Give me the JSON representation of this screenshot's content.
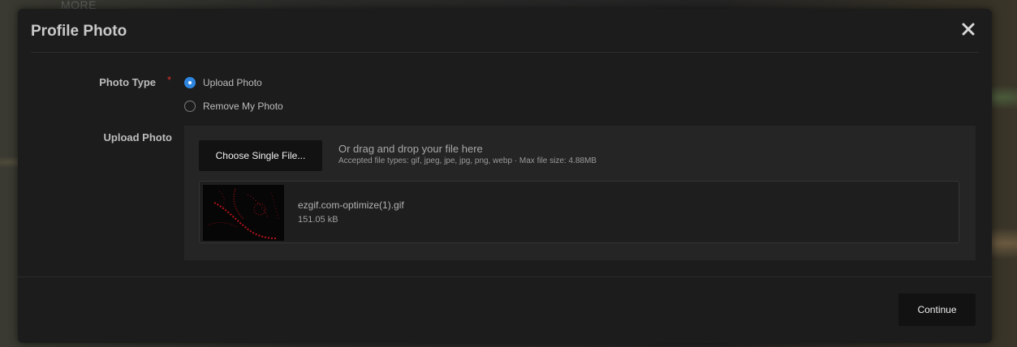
{
  "background": {
    "nav_label": "MORE"
  },
  "modal": {
    "title": "Profile Photo",
    "close_icon": "close-icon"
  },
  "photo_type": {
    "label": "Photo Type",
    "required_mark": "*",
    "options": [
      {
        "label": "Upload Photo",
        "checked": true
      },
      {
        "label": "Remove My Photo",
        "checked": false
      }
    ]
  },
  "upload": {
    "label": "Upload Photo",
    "choose_button": "Choose Single File...",
    "drop_text": "Or drag and drop your file here",
    "accepted_text": "Accepted file types: gif, jpeg, jpe, jpg, png, webp · Max file size: 4.88MB",
    "file": {
      "name": "ezgif.com-optimize(1).gif",
      "size": "151.05 kB"
    }
  },
  "footer": {
    "continue_button": "Continue"
  },
  "colors": {
    "accent": "#2f86e1",
    "required": "#d9312b",
    "modal_bg": "#1c1c1c",
    "panel_bg": "#252525",
    "button_bg": "#121212"
  }
}
